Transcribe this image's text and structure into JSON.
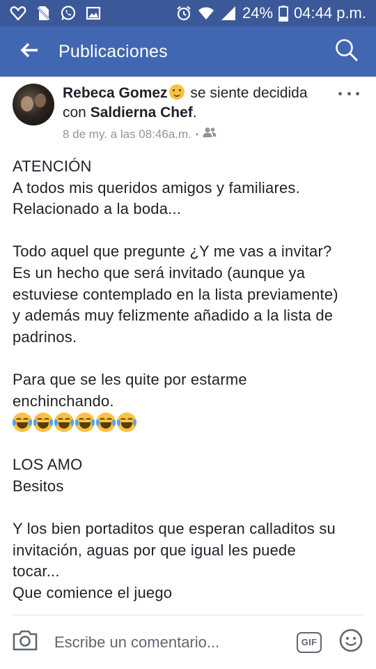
{
  "status_bar": {
    "battery": "24%",
    "time": "04:44 p.m.",
    "icons": [
      "heart-outline-icon",
      "no-sim-icon",
      "whatsapp-icon",
      "image-icon",
      "alarm-icon",
      "wifi-icon",
      "signal-icon",
      "battery-icon"
    ]
  },
  "app_bar": {
    "title": "Publicaciones",
    "back_icon": "arrow-left-icon",
    "search_icon": "search-icon",
    "background": "#4267b2"
  },
  "post": {
    "author": "Rebeca Gomez",
    "feeling_text": " se siente decidida con ",
    "tagged": "Saldierna Chef",
    "period": ".",
    "timestamp": "8 de my. a las 08:46a.m.",
    "separator": "•",
    "audience_icon": "friends-icon",
    "body": {
      "p1": "ATENCIÓN\nA todos mis queridos amigos y familiares.\nRelacionado a la boda...",
      "p2": "Todo aquel que pregunte ¿Y me vas a invitar?\nEs un hecho que será invitado (aunque ya\nestuviese contemplado en la lista previamente)\ny además muy felizmente añadido a la lista de\npadrinos.",
      "p3": "Para que se les quite por estarme\nenchinchando.",
      "emoji_count": 6,
      "p4": "LOS AMO\nBesitos",
      "p5": "Y los bien portaditos que esperan calladitos su\ninvitación, aguas por que igual les puede\ntocar...\nQue comience el juego"
    }
  },
  "comment_bar": {
    "placeholder": "Escribe un comentario...",
    "gif_label": "GIF"
  }
}
